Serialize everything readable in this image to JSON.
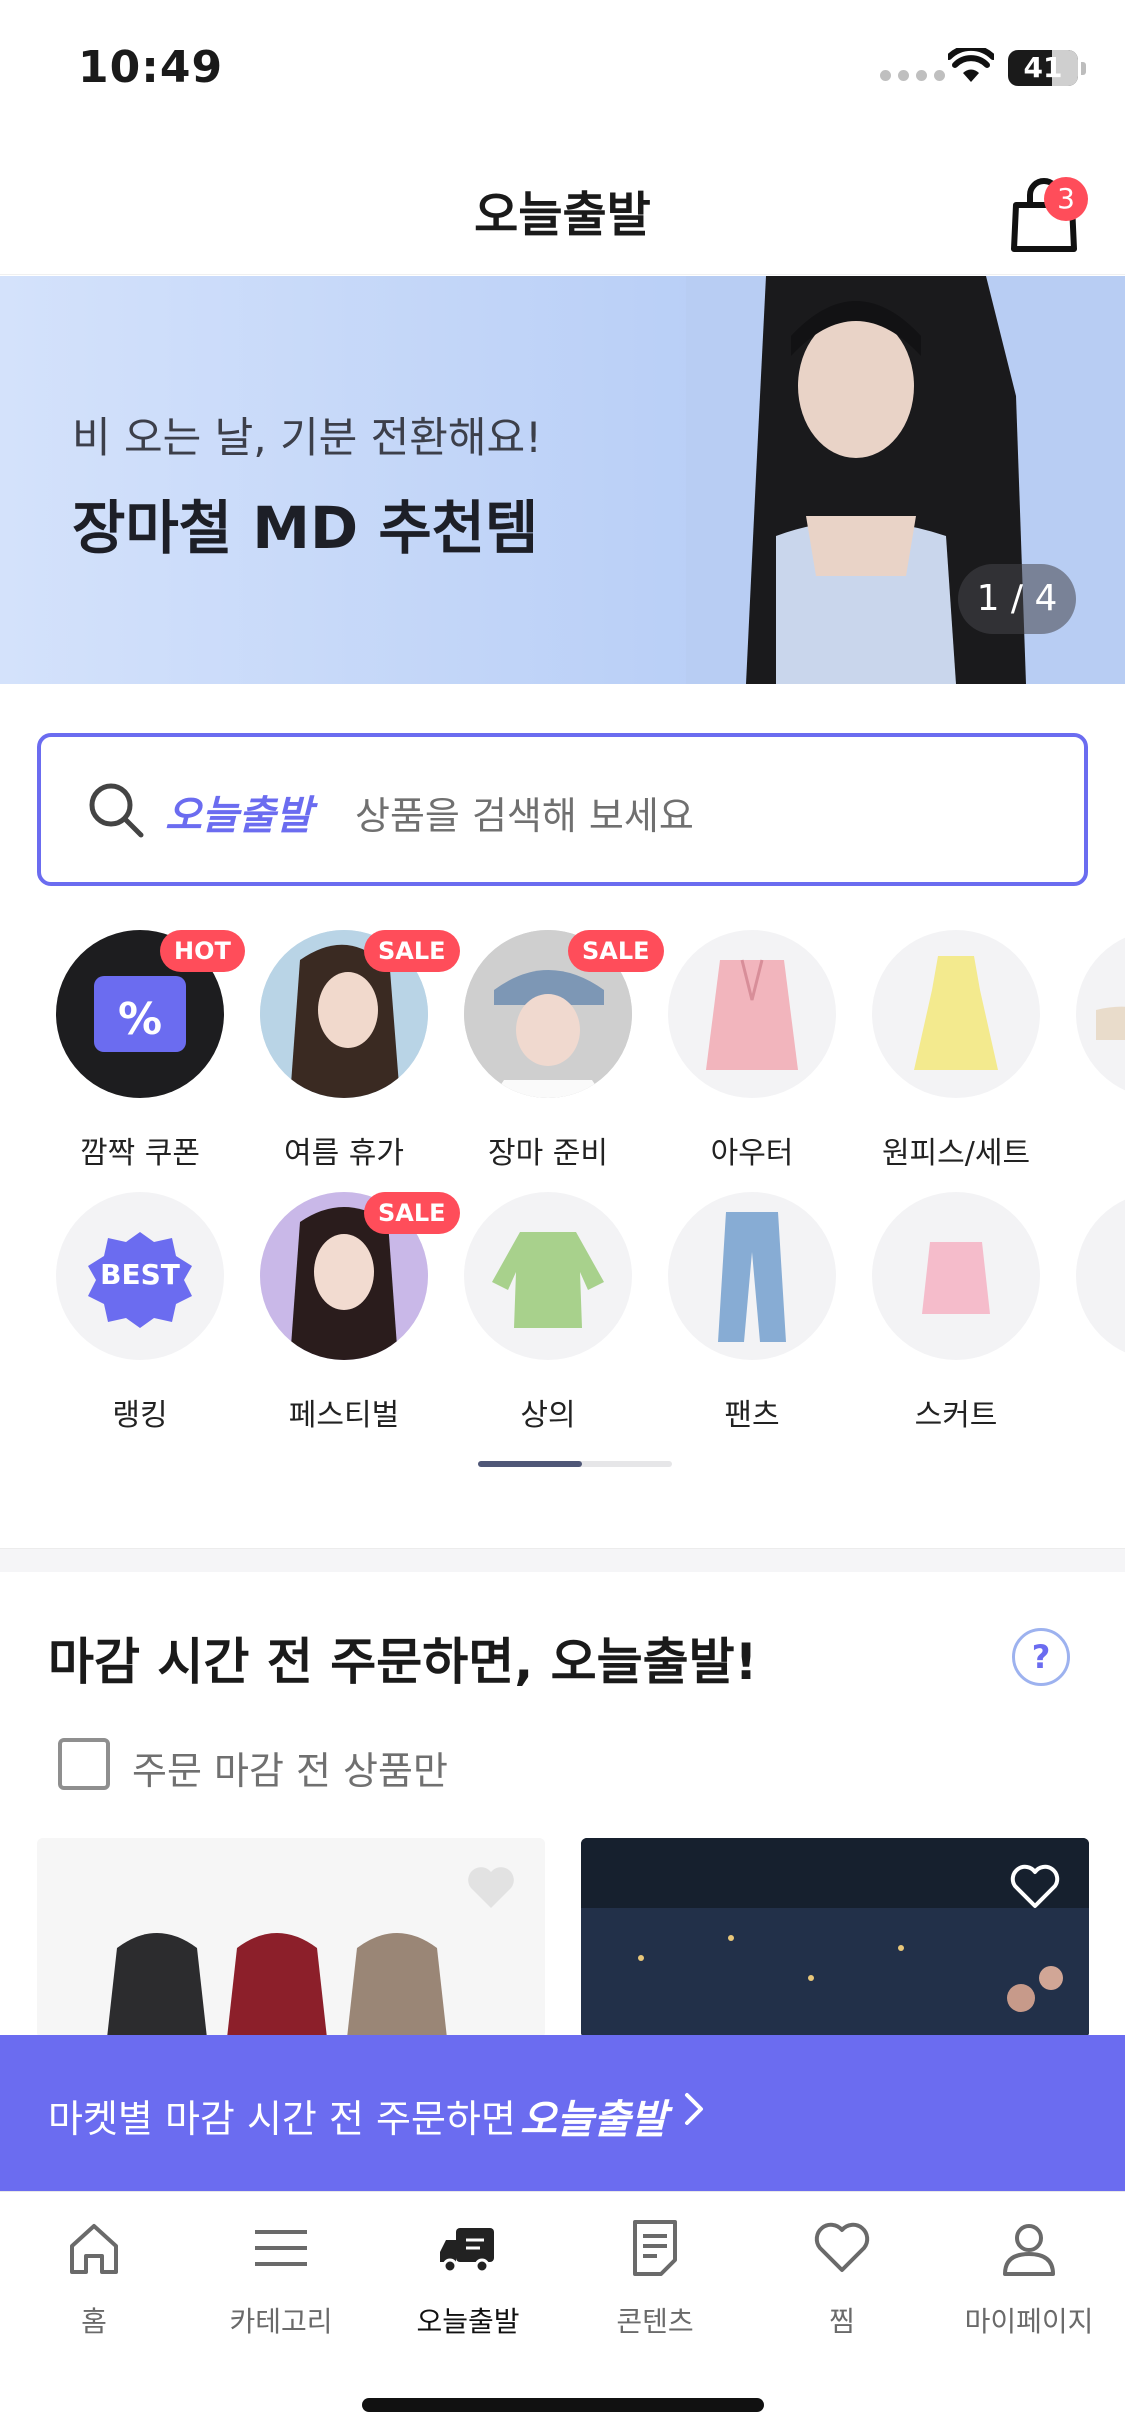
{
  "status_bar": {
    "time": "10:49",
    "battery": "41"
  },
  "header": {
    "title": "오늘출발",
    "cart_count": "3"
  },
  "banner": {
    "subtitle": "비 오는 날, 기분 전환해요!",
    "title": "장마철 MD 추천템",
    "pager": "1 / 4"
  },
  "search": {
    "brand": "오늘출발",
    "placeholder": "상품을 검색해 보세요"
  },
  "categories": [
    {
      "label": "깜짝 쿠폰",
      "tag": "HOT"
    },
    {
      "label": "여름 휴가",
      "tag": "SALE"
    },
    {
      "label": "장마 준비",
      "tag": "SALE"
    },
    {
      "label": "아우터",
      "tag": ""
    },
    {
      "label": "원피스/세트",
      "tag": ""
    },
    {
      "label": "랭킹",
      "tag": "",
      "badge_text": "BEST"
    },
    {
      "label": "페스티벌",
      "tag": "SALE"
    },
    {
      "label": "상의",
      "tag": ""
    },
    {
      "label": "팬츠",
      "tag": ""
    },
    {
      "label": "스커트",
      "tag": ""
    }
  ],
  "section": {
    "title": "마감 시간 전 주문하면, 오늘출발!",
    "help": "?",
    "checkbox_label": "주문 마감 전 상품만"
  },
  "notice": {
    "text": "마켓별 마감 시간 전 주문하면",
    "brand": "오늘출발"
  },
  "tabbar": [
    {
      "label": "홈"
    },
    {
      "label": "카테고리"
    },
    {
      "label": "오늘출발"
    },
    {
      "label": "콘텐츠"
    },
    {
      "label": "찜"
    },
    {
      "label": "마이페이지"
    }
  ],
  "colors": {
    "accent": "#6b6cf0",
    "badge_red": "#ff4d5a"
  }
}
